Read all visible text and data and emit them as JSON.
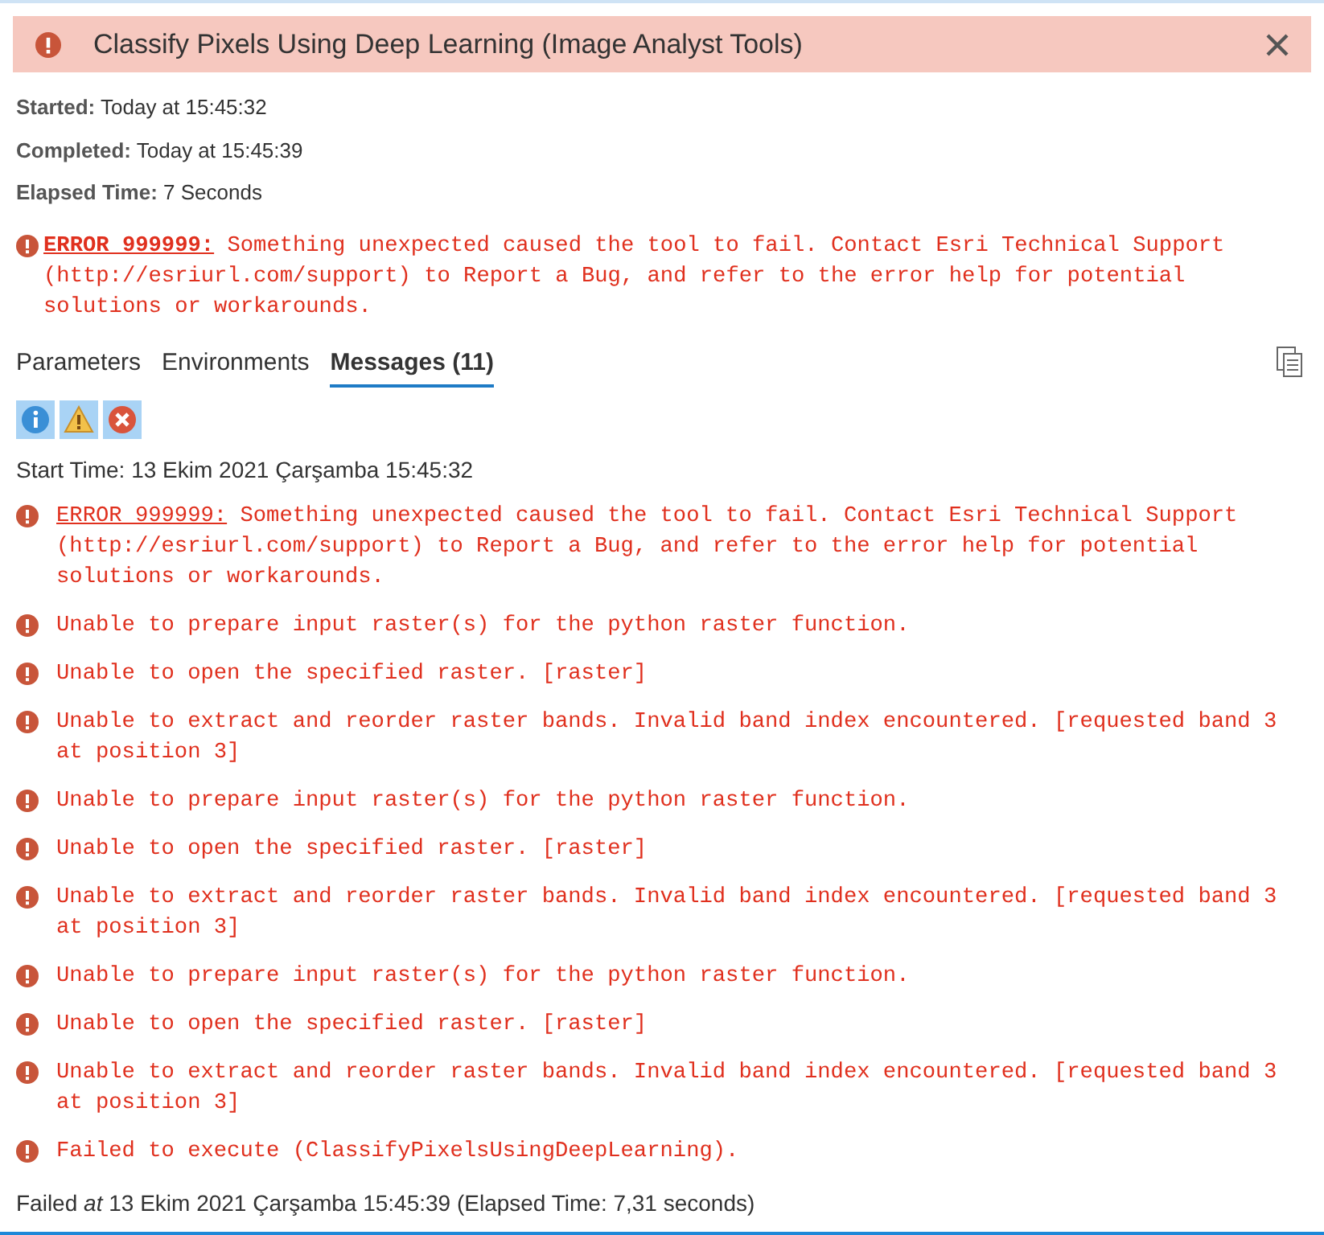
{
  "header": {
    "title": "Classify Pixels Using Deep Learning (Image Analyst Tools)"
  },
  "details": [
    {
      "label": "Started:",
      "value": "Today at 15:45:32"
    },
    {
      "label": "Completed:",
      "value": "Today at 15:45:39"
    },
    {
      "label": "Elapsed Time:",
      "value": "7 Seconds"
    }
  ],
  "summary_error": {
    "code": "ERROR 999999:",
    "text": "Something unexpected caused the tool to fail. Contact Esri Technical Support (http://esriurl.com/support) to Report a Bug, and refer to the error help for potential solutions or workarounds."
  },
  "tabs": [
    {
      "label": "Parameters",
      "selected": false
    },
    {
      "label": "Environments",
      "selected": false
    },
    {
      "label": "Messages (11)",
      "selected": true
    }
  ],
  "filters": [
    {
      "kind": "info",
      "selected": true
    },
    {
      "kind": "warning",
      "selected": true
    },
    {
      "kind": "error",
      "selected": true
    }
  ],
  "messages": [
    {
      "kind": "info",
      "text": "Start Time: 13 Ekim 2021 Çarşamba 15:45:32"
    },
    {
      "kind": "error",
      "code": "ERROR 999999:",
      "text": "Something unexpected caused the tool to fail. Contact Esri Technical Support (http://esriurl.com/support) to Report a Bug, and refer to the error help for potential solutions or workarounds."
    },
    {
      "kind": "error",
      "text": "Unable to prepare input raster(s) for the python raster function."
    },
    {
      "kind": "error",
      "text": "Unable to open the specified raster. [raster]"
    },
    {
      "kind": "error",
      "text": "Unable to extract and reorder raster bands. Invalid band index encountered. [requested band 3 at position 3]"
    },
    {
      "kind": "error",
      "text": "Unable to prepare input raster(s) for the python raster function."
    },
    {
      "kind": "error",
      "text": "Unable to open the specified raster. [raster]"
    },
    {
      "kind": "error",
      "text": "Unable to extract and reorder raster bands. Invalid band index encountered. [requested band 3 at position 3]"
    },
    {
      "kind": "error",
      "text": "Unable to prepare input raster(s) for the python raster function."
    },
    {
      "kind": "error",
      "text": "Unable to open the specified raster. [raster]"
    },
    {
      "kind": "error",
      "text": "Unable to extract and reorder raster bands. Invalid band index encountered. [requested band 3 at position 3]"
    },
    {
      "kind": "error",
      "text": "Failed to execute (ClassifyPixelsUsingDeepLearning)."
    },
    {
      "kind": "info",
      "text": "Failed *at* 13 Ekim 2021 Çarşamba 15:45:39 (Elapsed Time: 7,31 seconds)"
    }
  ]
}
